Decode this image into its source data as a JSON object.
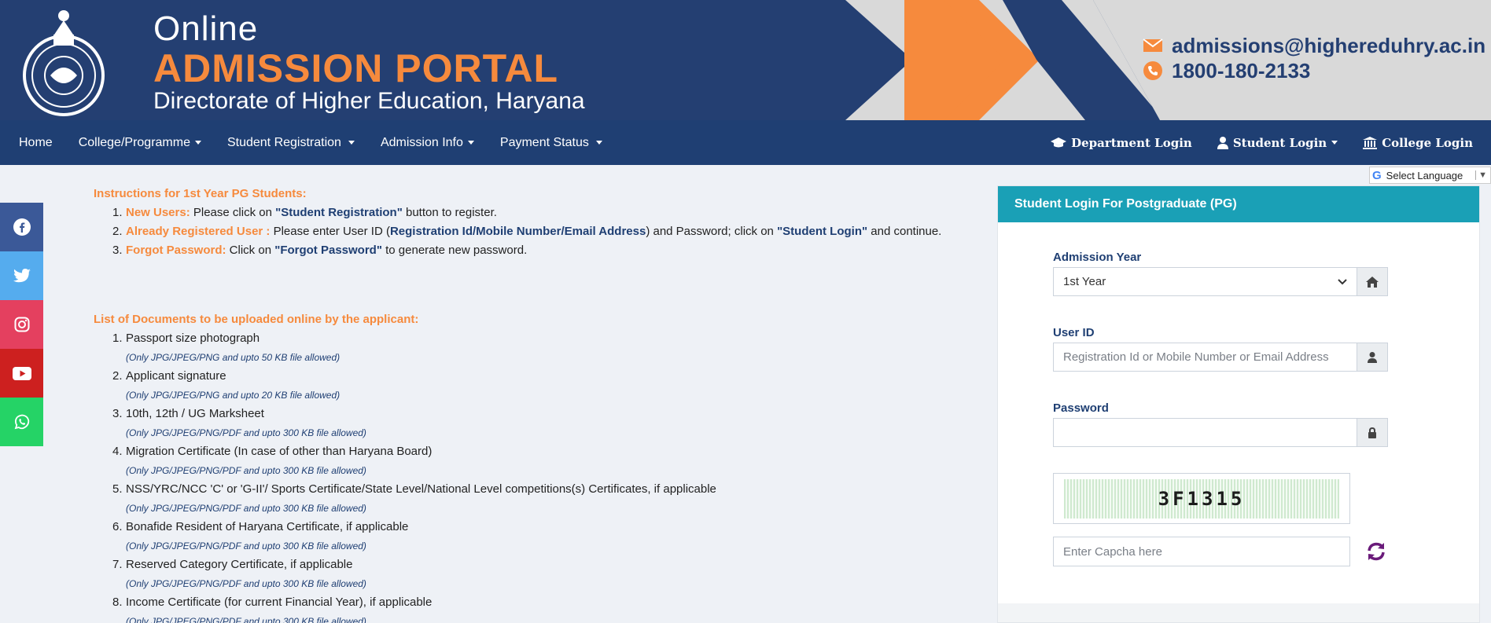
{
  "header": {
    "online": "Online",
    "portal": "ADMISSION PORTAL",
    "directorate": "Directorate of Higher Education, Haryana",
    "email": "admissions@highereduhry.ac.in",
    "phone": "1800-180-2133",
    "colors": {
      "navy": "#243f72",
      "orange": "#f68a3d",
      "grey": "#d9d9d9"
    }
  },
  "nav": {
    "home": "Home",
    "college": "College/Programme",
    "student_registration": "Student Registration",
    "admission_info": "Admission Info",
    "payment_status": "Payment Status",
    "department_login": "Department Login",
    "student_login": "Student Login",
    "college_login": "College Login"
  },
  "language": {
    "label": "Select Language",
    "g": "G",
    "arrow": "▼"
  },
  "social": [
    "facebook-icon",
    "twitter-icon",
    "instagram-icon",
    "youtube-icon",
    "whatsapp-icon"
  ],
  "instructions": {
    "title": "Instructions for 1st Year PG Students:",
    "items": [
      {
        "num": "1.",
        "label": "New Users:",
        "t1": " Please click on ",
        "b1": "\"Student Registration\"",
        "t2": " button to register."
      },
      {
        "num": "2.",
        "label": "Already Registered User :",
        "t1": " Please enter User ID (",
        "b1": "Registration Id/Mobile Number/Email Address",
        "t2": ") and Password; click on ",
        "b2": "\"Student Login\"",
        "t3": " and continue."
      },
      {
        "num": "3.",
        "label": "Forgot Password:",
        "t1": " Click on ",
        "b1": "\"Forgot Password\"",
        "t2": " to generate new password."
      }
    ]
  },
  "documents": {
    "title": "List of Documents to be uploaded online by the applicant:",
    "items": [
      {
        "num": "1.",
        "title": "Passport size photograph",
        "note": "(Only JPG/JPEG/PNG and upto 50 KB file allowed)"
      },
      {
        "num": "2.",
        "title": "Applicant signature",
        "note": "(Only JPG/JPEG/PNG and upto 20 KB file allowed)"
      },
      {
        "num": "3.",
        "title": "10th, 12th / UG Marksheet",
        "note": "(Only JPG/JPEG/PNG/PDF and upto 300 KB file allowed)"
      },
      {
        "num": "4.",
        "title": "Migration Certificate (In case of other than Haryana Board)",
        "note": "(Only JPG/JPEG/PNG/PDF and upto 300 KB file allowed)"
      },
      {
        "num": "5.",
        "title": "NSS/YRC/NCC 'C' or 'G-II'/ Sports Certificate/State Level/National Level competitions(s) Certificates, if applicable",
        "note": "(Only JPG/JPEG/PNG/PDF and upto 300 KB file allowed)"
      },
      {
        "num": "6.",
        "title": "Bonafide Resident of Haryana Certificate, if applicable",
        "note": "(Only JPG/JPEG/PNG/PDF and upto 300 KB file allowed)"
      },
      {
        "num": "7.",
        "title": "Reserved Category Certificate, if applicable",
        "note": "(Only JPG/JPEG/PNG/PDF and upto 300 KB file allowed)"
      },
      {
        "num": "8.",
        "title": "Income Certificate (for current Financial Year), if applicable",
        "note": "(Only JPG/JPEG/PNG/PDF and upto 300 KB file allowed)"
      }
    ]
  },
  "login": {
    "title": "Student Login For Postgraduate (PG)",
    "admission_year_label": "Admission Year",
    "admission_year_value": "1st Year",
    "userid_label": "User ID",
    "userid_placeholder": "Registration Id or Mobile Number or Email Address",
    "password_label": "Password",
    "captcha_text": "3F1315",
    "captcha_placeholder": "Enter Capcha here"
  }
}
